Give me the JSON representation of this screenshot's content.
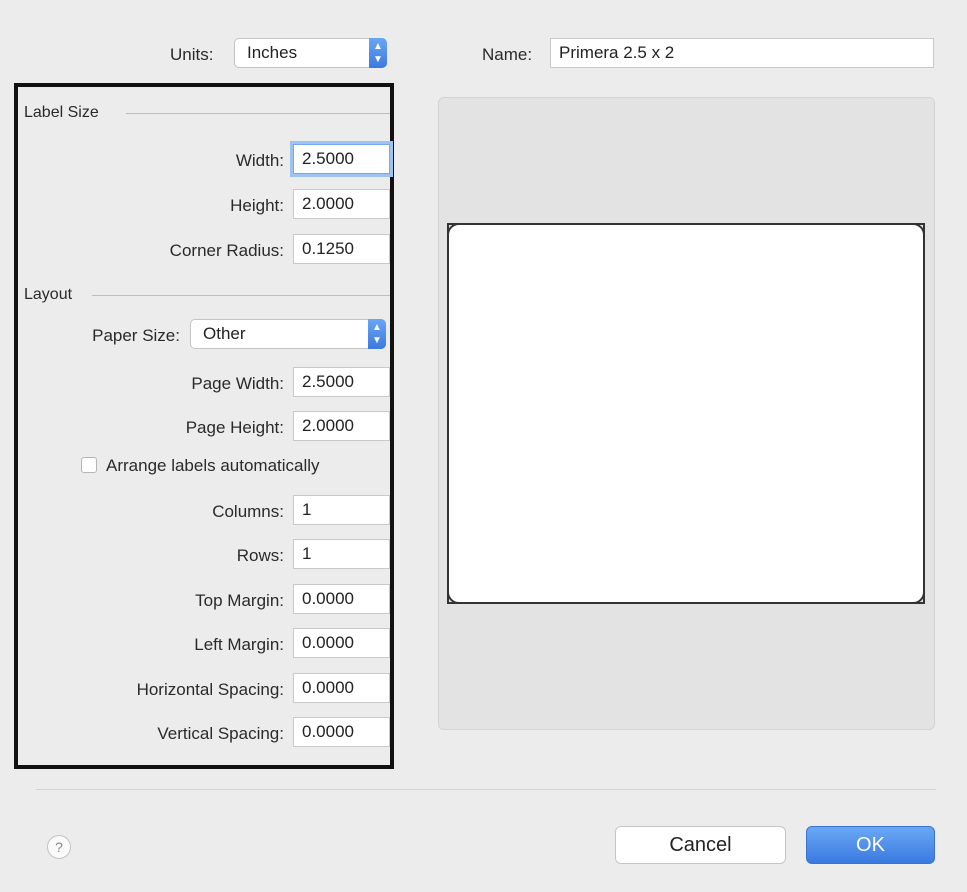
{
  "units": {
    "label": "Units:",
    "value": "Inches"
  },
  "name": {
    "label": "Name:",
    "value": "Primera 2.5 x 2"
  },
  "label_size": {
    "section_title": "Label Size",
    "width": {
      "label": "Width:",
      "value": "2.5000"
    },
    "height": {
      "label": "Height:",
      "value": "2.0000"
    },
    "corner_radius": {
      "label": "Corner Radius:",
      "value": "0.1250"
    }
  },
  "layout": {
    "section_title": "Layout",
    "paper_size": {
      "label": "Paper Size:",
      "value": "Other"
    },
    "page_width": {
      "label": "Page Width:",
      "value": "2.5000"
    },
    "page_height": {
      "label": "Page Height:",
      "value": "2.0000"
    },
    "arrange": {
      "label": "Arrange labels automatically",
      "checked": false
    },
    "columns": {
      "label": "Columns:",
      "value": "1"
    },
    "rows": {
      "label": "Rows:",
      "value": "1"
    },
    "top_margin": {
      "label": "Top Margin:",
      "value": "0.0000"
    },
    "left_margin": {
      "label": "Left Margin:",
      "value": "0.0000"
    },
    "horizontal_spacing": {
      "label": "Horizontal Spacing:",
      "value": "0.0000"
    },
    "vertical_spacing": {
      "label": "Vertical Spacing:",
      "value": "0.0000"
    }
  },
  "buttons": {
    "help": "?",
    "cancel": "Cancel",
    "ok": "OK"
  },
  "colors": {
    "accent": "#3b7be0",
    "highlight_border": "#111111"
  }
}
